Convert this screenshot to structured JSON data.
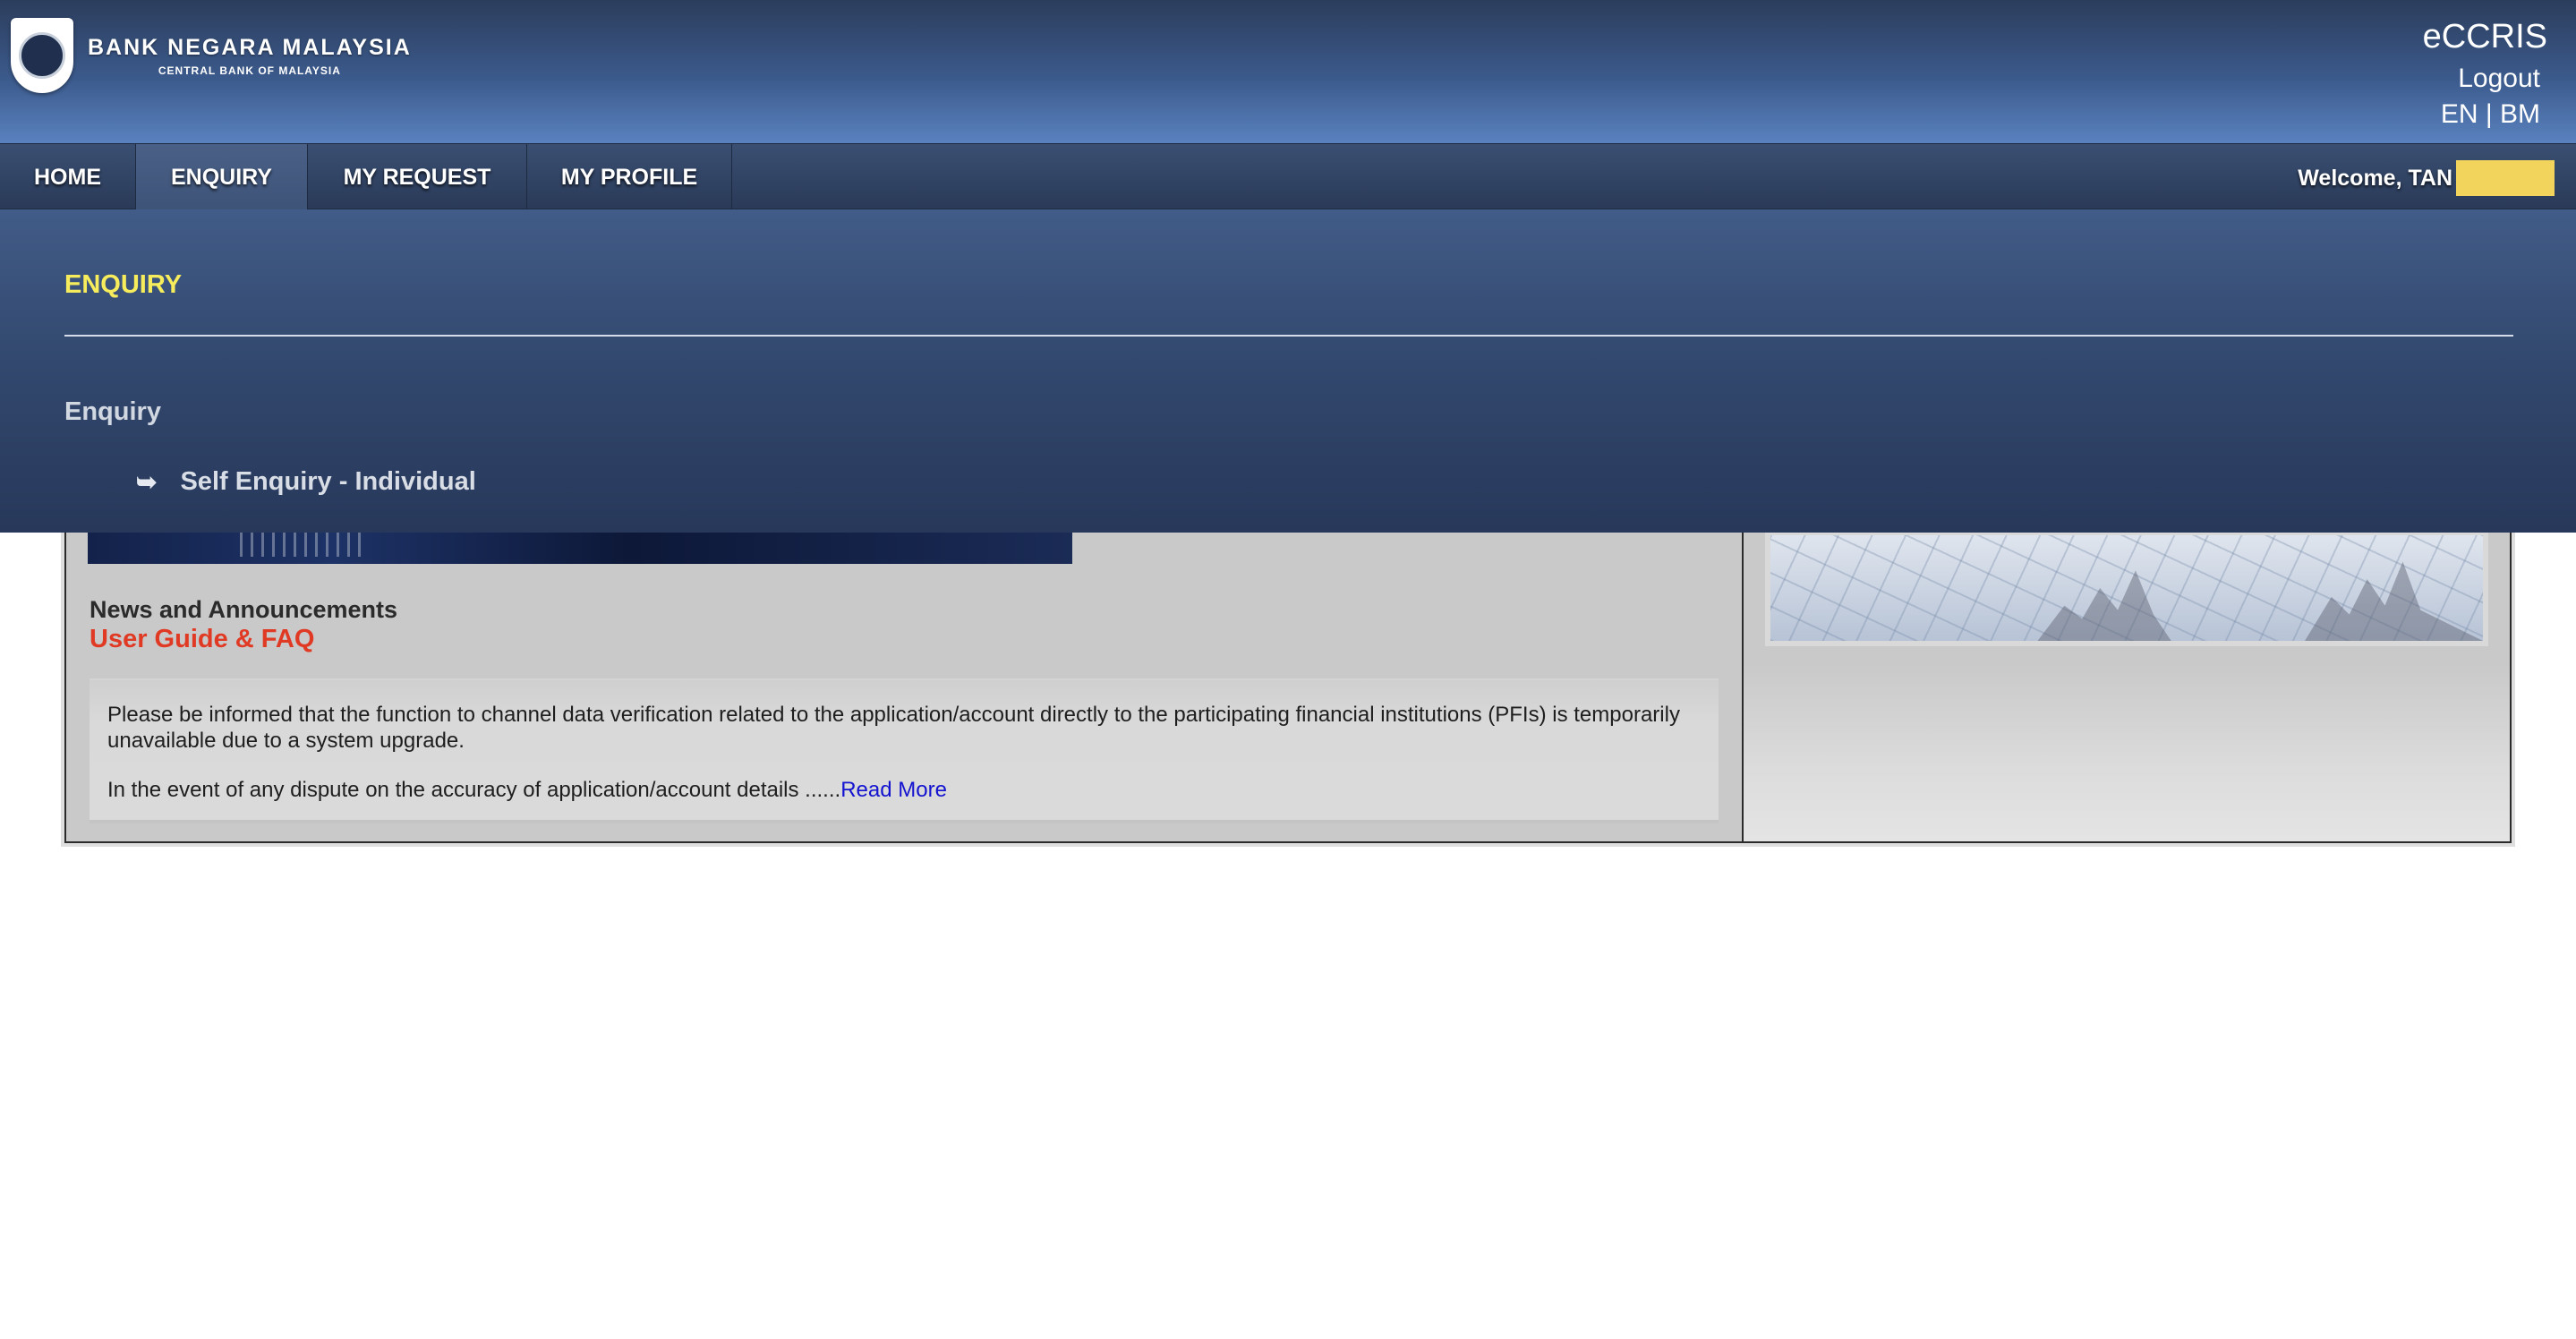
{
  "header": {
    "logo_main": "BANK NEGARA MALAYSIA",
    "logo_sub": "CENTRAL BANK OF MALAYSIA",
    "app_title": "eCCRIS",
    "logout_label": "Logout",
    "lang_en": "EN",
    "lang_separator": " | ",
    "lang_bm": "BM"
  },
  "nav": {
    "items": [
      {
        "label": "HOME"
      },
      {
        "label": "ENQUIRY",
        "active": true
      },
      {
        "label": "MY REQUEST"
      },
      {
        "label": "MY PROFILE"
      }
    ],
    "welcome_text": "Welcome, TAN"
  },
  "dropdown": {
    "title": "ENQUIRY",
    "section_heading": "Enquiry",
    "arrow_icon": "➥",
    "link_label": "Self Enquiry - Individual"
  },
  "content": {
    "news_title": "News and Announcements",
    "guide_link": "User Guide & FAQ",
    "notice_paragraph_1": "Please be informed that the function to channel data verification related to the application/account directly to the participating financial institutions (PFIs) is temporarily unavailable due to a system upgrade.",
    "notice_paragraph_2": "In the event of any dispute on the accuracy of application/account details ......",
    "read_more_label": "Read More"
  },
  "colors": {
    "header_gradient_top": "#2c3d5c",
    "header_gradient_bottom": "#5a82bf",
    "dropdown_title": "#f7ec5c",
    "guide_link": "#e03a24",
    "read_more": "#1313d0",
    "redaction": "#f2d45c"
  }
}
